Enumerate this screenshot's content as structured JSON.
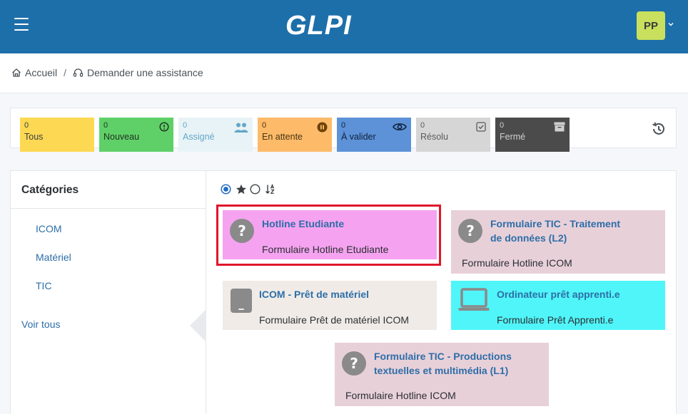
{
  "header": {
    "logo_text": "GLPI",
    "avatar_initials": "PP",
    "bg_color": "#1d6faa"
  },
  "breadcrumb": {
    "home": "Accueil",
    "separator": "/",
    "current": "Demander une assistance"
  },
  "tiles": [
    {
      "count": "0",
      "label": "Tous",
      "bg": "#fdd852",
      "color": "#3a3f44",
      "icon": "none"
    },
    {
      "count": "0",
      "label": "Nouveau",
      "bg": "#5fd068",
      "color": "#223322",
      "icon": "alert-circle-icon"
    },
    {
      "count": "0",
      "label": "Assigné",
      "bg": "#e8f3f7",
      "color": "#64a7c6",
      "icon": "users-icon"
    },
    {
      "count": "0",
      "label": "En attente",
      "bg": "#fdbb6a",
      "color": "#4a3310",
      "icon": "pause-icon"
    },
    {
      "count": "0",
      "label": "À valider",
      "bg": "#5d92d8",
      "color": "#10213a",
      "icon": "eye-icon"
    },
    {
      "count": "0",
      "label": "Résolu",
      "bg": "#d6d6d6",
      "color": "#5a5a5a",
      "icon": "checkbox-icon"
    },
    {
      "count": "0",
      "label": "Fermé",
      "bg": "#4b4b4b",
      "color": "#cfcfcf",
      "icon": "archive-icon"
    }
  ],
  "sidebar": {
    "title": "Catégories",
    "categories": [
      "ICOM",
      "Matériel",
      "TIC"
    ],
    "view_all": "Voir tous"
  },
  "forms": [
    {
      "title_lines": [
        "Hotline Etudiante"
      ],
      "description": "Formulaire Hotline Etudiante",
      "bg": "#f5a3f0",
      "icon": "question-icon"
    },
    {
      "title_lines": [
        "Formulaire TIC - Traitement",
        "de données (L2)"
      ],
      "description": "Formulaire Hotline ICOM",
      "bg": "#e8d0d9",
      "icon": "question-icon"
    },
    {
      "title_lines": [
        "ICOM - Prêt de matériel"
      ],
      "description": "Formulaire Prêt de matériel ICOM",
      "bg": "#f0ebe7",
      "icon": "tablet-icon"
    },
    {
      "title_lines": [
        "Ordinateur prêt apprenti.e"
      ],
      "description": "Formulaire Prêt Apprenti.e",
      "bg": "#4ff5f9",
      "icon": "laptop-icon"
    },
    {
      "title_lines": [
        "Formulaire TIC - Productions",
        "textuelles et multimédia (L1)"
      ],
      "description": "Formulaire Hotline ICOM",
      "bg": "#e8d0d9",
      "icon": "question-icon"
    }
  ]
}
